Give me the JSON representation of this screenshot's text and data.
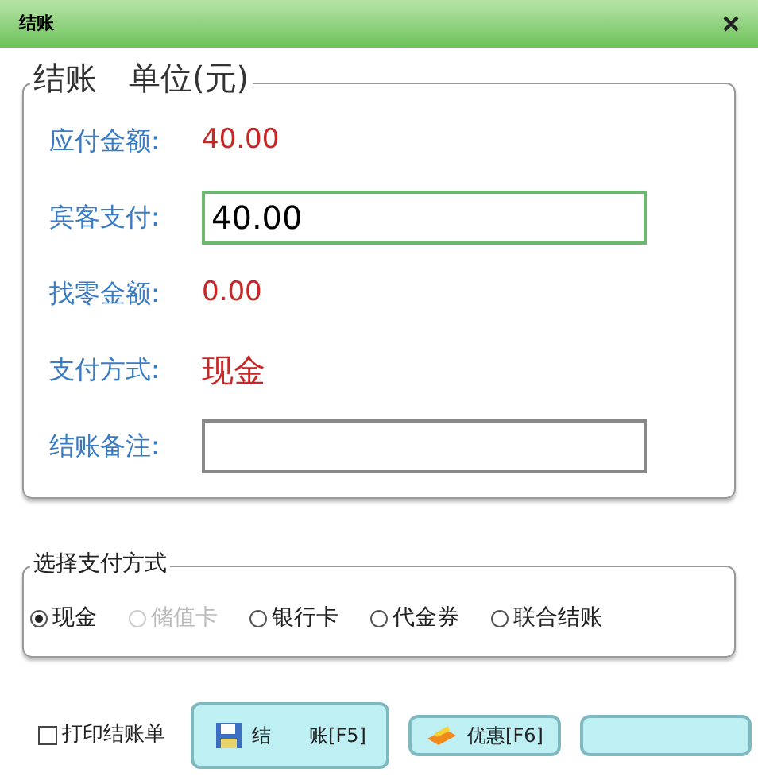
{
  "window": {
    "title": "结账"
  },
  "checkout": {
    "legend": "结账　单位(元)",
    "fields": [
      {
        "kind": "value",
        "label": "应付金额:",
        "value": "40.00"
      },
      {
        "kind": "input",
        "label": "宾客支付:",
        "value": "40.00",
        "focused": true
      },
      {
        "kind": "value",
        "label": "找零金额:",
        "value": "0.00"
      },
      {
        "kind": "big",
        "label": "支付方式:",
        "value": "现金"
      },
      {
        "kind": "input",
        "label": "结账备注:",
        "focused": false
      }
    ]
  },
  "payment_methods": {
    "legend": "选择支付方式",
    "options": [
      {
        "label": "现金",
        "selected": true,
        "disabled": false
      },
      {
        "label": "储值卡",
        "selected": false,
        "disabled": true
      },
      {
        "label": "银行卡",
        "selected": false,
        "disabled": false
      },
      {
        "label": "代金券",
        "selected": false,
        "disabled": false
      },
      {
        "label": "联合结账",
        "selected": false,
        "disabled": false
      }
    ]
  },
  "print_receipt": {
    "label": "打印结账单",
    "checked": false
  },
  "buttons": [
    {
      "kind": "checkout",
      "label": "结　　账[F5]"
    },
    {
      "kind": "discount",
      "label": "优惠[F6]"
    },
    {
      "kind": "cancel"
    }
  ]
}
